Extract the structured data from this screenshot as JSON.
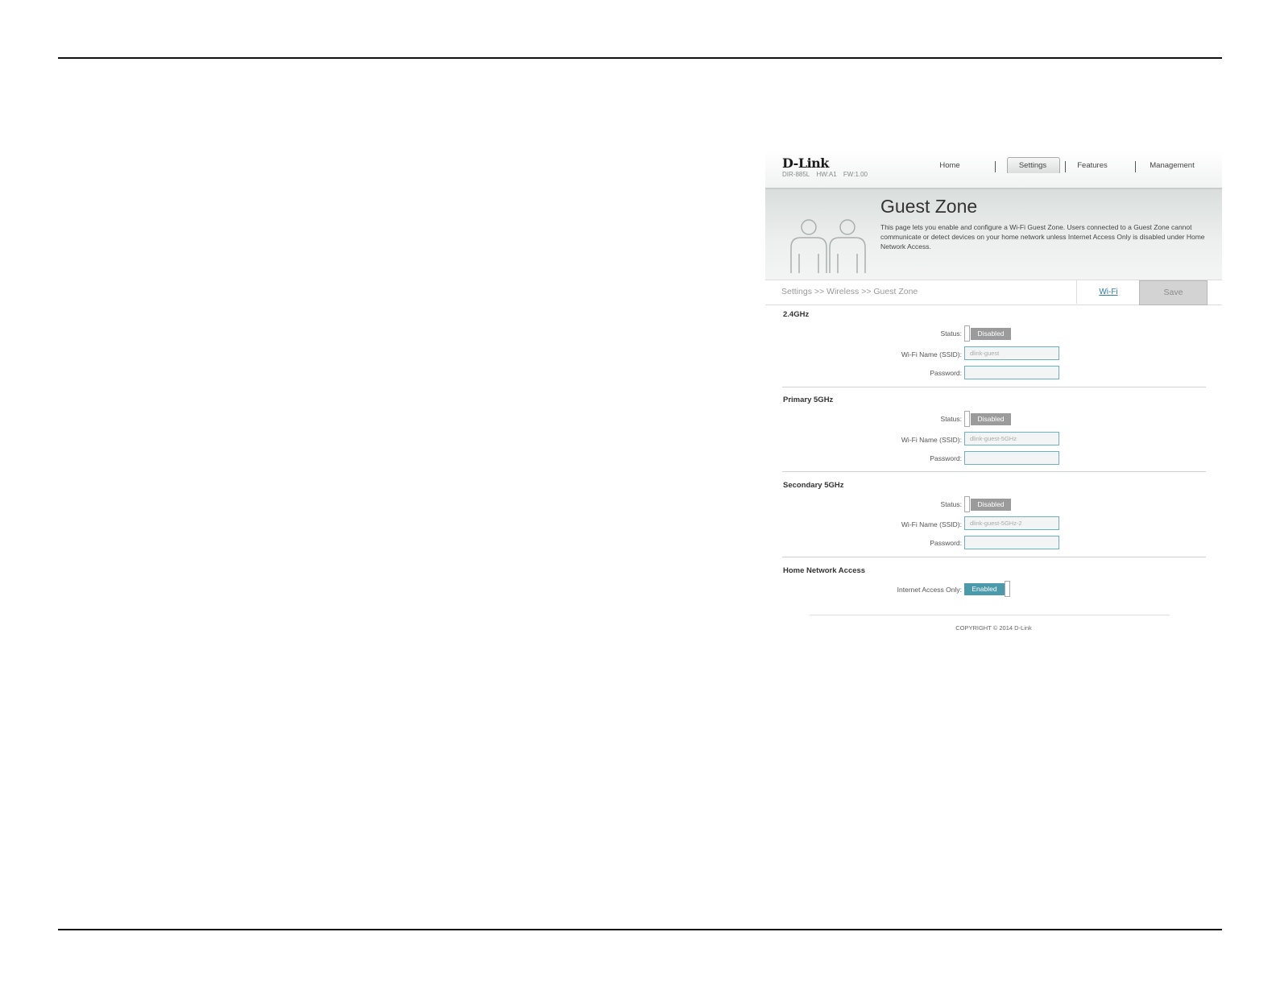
{
  "header": {
    "logo": "D-Link",
    "model": "DIR-885L",
    "hw": "HW:A1",
    "fw": "FW:1.00",
    "nav": [
      "Home",
      "Settings",
      "Features",
      "Management"
    ],
    "active_nav": "Settings"
  },
  "banner": {
    "title": "Guest Zone",
    "description": "This page lets you enable and configure a Wi-Fi Guest Zone. Users connected to a Guest Zone cannot communicate or detect devices on your home network unless Internet Access Only is disabled under Home Network Access."
  },
  "breadcrumb": "Settings >> Wireless >> Guest Zone",
  "wifi_link": "Wi-Fi",
  "save_label": "Save",
  "sections": [
    {
      "title": "2.4GHz",
      "status_label": "Status:",
      "status_value": "Disabled",
      "ssid_label": "Wi-Fi Name (SSID):",
      "ssid_value": "dlink-guest",
      "password_label": "Password:",
      "password_value": ""
    },
    {
      "title": "Primary 5GHz",
      "status_label": "Status:",
      "status_value": "Disabled",
      "ssid_label": "Wi-Fi Name (SSID):",
      "ssid_value": "dlink-guest-5GHz",
      "password_label": "Password:",
      "password_value": ""
    },
    {
      "title": "Secondary 5GHz",
      "status_label": "Status:",
      "status_value": "Disabled",
      "ssid_label": "Wi-Fi Name (SSID):",
      "ssid_value": "dlink-guest-5GHz-2",
      "password_label": "Password:",
      "password_value": ""
    }
  ],
  "home_network": {
    "title": "Home Network Access",
    "internet_label": "Internet Access Only:",
    "internet_value": "Enabled"
  },
  "footer": "COPYRIGHT © 2014 D-Link",
  "colors": {
    "enabled": "#4a9aab",
    "disabled": "#9b9b9b",
    "link": "#2b7ab0"
  }
}
